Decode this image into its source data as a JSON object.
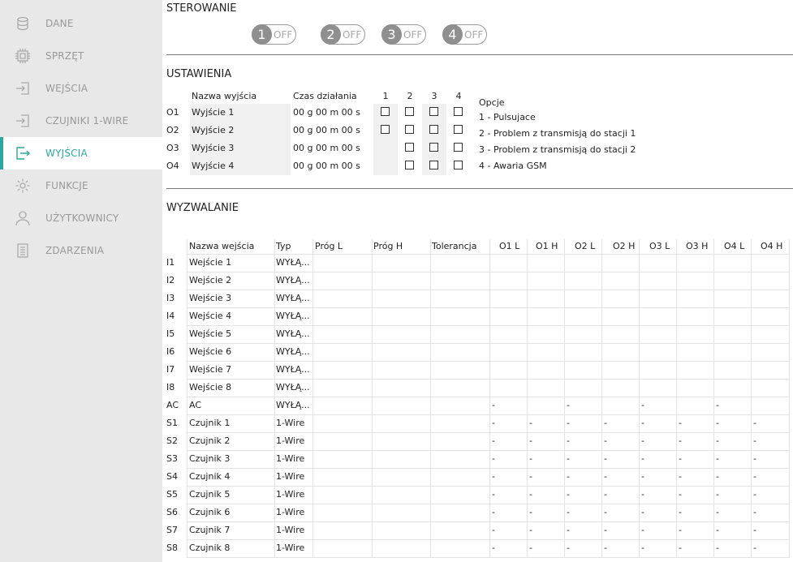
{
  "sidebar": {
    "items": [
      {
        "label": "DANE",
        "icon": "database-icon"
      },
      {
        "label": "SPRZĘT",
        "icon": "chip-icon"
      },
      {
        "label": "WEJŚCIA",
        "icon": "input-icon"
      },
      {
        "label": "CZUJNIKI 1-WIRE",
        "icon": "sensor-input-icon"
      },
      {
        "label": "WYJŚCIA",
        "icon": "output-icon",
        "active": true
      },
      {
        "label": "FUNKCJE",
        "icon": "gear-icon"
      },
      {
        "label": "UŻYTKOWNICY",
        "icon": "user-icon"
      },
      {
        "label": "ZDARZENIA",
        "icon": "list-icon"
      }
    ],
    "accent_color": "#2aa8a0"
  },
  "control": {
    "title": "STEROWANIE",
    "toggles": [
      {
        "number": "1",
        "state": "OFF"
      },
      {
        "number": "2",
        "state": "OFF"
      },
      {
        "number": "3",
        "state": "OFF"
      },
      {
        "number": "4",
        "state": "OFF"
      }
    ]
  },
  "settings": {
    "title": "USTAWIENIA",
    "headers": {
      "name": "Nazwa wyjścia",
      "time": "Czas działania",
      "c1": "1",
      "c2": "2",
      "c3": "3",
      "c4": "4"
    },
    "rows": [
      {
        "id": "O1",
        "name": "Wyjście 1",
        "time": "00 g 00 m 00 s",
        "checks": [
          true,
          true,
          true,
          true
        ]
      },
      {
        "id": "O2",
        "name": "Wyjście 2",
        "time": "00 g 00 m 00 s",
        "checks": [
          true,
          true,
          true,
          true
        ]
      },
      {
        "id": "O3",
        "name": "Wyjście 3",
        "time": "00 g 00 m 00 s",
        "checks": [
          false,
          true,
          true,
          true
        ]
      },
      {
        "id": "O4",
        "name": "Wyjście 4",
        "time": "00 g 00 m 00 s",
        "checks": [
          false,
          true,
          true,
          true
        ]
      }
    ],
    "options_title": "Opcje",
    "options": [
      "1 - Pulsujace",
      "2 - Problem z transmisją do stacji 1",
      "3 - Problem z transmisją do stacji 2",
      "4 - Awaria GSM"
    ]
  },
  "trigger": {
    "title": "WYZWALANIE",
    "headers": [
      "Nazwa wejścia",
      "Typ",
      "Próg L",
      "Próg H",
      "Tolerancja",
      "O1 L",
      "O1 H",
      "O2 L",
      "O2 H",
      "O3 L",
      "O3 H",
      "O4 L",
      "O4 H"
    ],
    "rows": [
      {
        "id": "I1",
        "name": "Wejście 1",
        "type": "WYŁĄ...",
        "cells": [
          "",
          "",
          "",
          "",
          "",
          "",
          "",
          "",
          "",
          "",
          ""
        ]
      },
      {
        "id": "I2",
        "name": "Wejście 2",
        "type": "WYŁĄ...",
        "cells": [
          "",
          "",
          "",
          "",
          "",
          "",
          "",
          "",
          "",
          "",
          ""
        ]
      },
      {
        "id": "I3",
        "name": "Wejście 3",
        "type": "WYŁĄ...",
        "cells": [
          "",
          "",
          "",
          "",
          "",
          "",
          "",
          "",
          "",
          "",
          ""
        ]
      },
      {
        "id": "I4",
        "name": "Wejście 4",
        "type": "WYŁĄ...",
        "cells": [
          "",
          "",
          "",
          "",
          "",
          "",
          "",
          "",
          "",
          "",
          ""
        ]
      },
      {
        "id": "I5",
        "name": "Wejście 5",
        "type": "WYŁĄ...",
        "cells": [
          "",
          "",
          "",
          "",
          "",
          "",
          "",
          "",
          "",
          "",
          ""
        ]
      },
      {
        "id": "I6",
        "name": "Wejście 6",
        "type": "WYŁĄ...",
        "cells": [
          "",
          "",
          "",
          "",
          "",
          "",
          "",
          "",
          "",
          "",
          ""
        ]
      },
      {
        "id": "I7",
        "name": "Wejście 7",
        "type": "WYŁĄ...",
        "cells": [
          "",
          "",
          "",
          "",
          "",
          "",
          "",
          "",
          "",
          "",
          ""
        ]
      },
      {
        "id": "I8",
        "name": "Wejście 8",
        "type": "WYŁĄ...",
        "cells": [
          "",
          "",
          "",
          "",
          "",
          "",
          "",
          "",
          "",
          "",
          ""
        ]
      },
      {
        "id": "AC",
        "name": "AC",
        "type": "WYŁĄ...",
        "cells": [
          "",
          "",
          "",
          "-",
          "",
          "-",
          "",
          "-",
          "",
          "-",
          ""
        ]
      },
      {
        "id": "S1",
        "name": "Czujnik 1",
        "type": "1-Wire",
        "cells": [
          "",
          "",
          "",
          "-",
          "-",
          "-",
          "-",
          "-",
          "-",
          "-",
          "-"
        ]
      },
      {
        "id": "S2",
        "name": "Czujnik 2",
        "type": "1-Wire",
        "cells": [
          "",
          "",
          "",
          "-",
          "-",
          "-",
          "-",
          "-",
          "-",
          "-",
          "-"
        ]
      },
      {
        "id": "S3",
        "name": "Czujnik 3",
        "type": "1-Wire",
        "cells": [
          "",
          "",
          "",
          "-",
          "-",
          "-",
          "-",
          "-",
          "-",
          "-",
          "-"
        ]
      },
      {
        "id": "S4",
        "name": "Czujnik 4",
        "type": "1-Wire",
        "cells": [
          "",
          "",
          "",
          "-",
          "-",
          "-",
          "-",
          "-",
          "-",
          "-",
          "-"
        ]
      },
      {
        "id": "S5",
        "name": "Czujnik 5",
        "type": "1-Wire",
        "cells": [
          "",
          "",
          "",
          "-",
          "-",
          "-",
          "-",
          "-",
          "-",
          "-",
          "-"
        ]
      },
      {
        "id": "S6",
        "name": "Czujnik 6",
        "type": "1-Wire",
        "cells": [
          "",
          "",
          "",
          "-",
          "-",
          "-",
          "-",
          "-",
          "-",
          "-",
          "-"
        ]
      },
      {
        "id": "S7",
        "name": "Czujnik 7",
        "type": "1-Wire",
        "cells": [
          "",
          "",
          "",
          "-",
          "-",
          "-",
          "-",
          "-",
          "-",
          "-",
          "-"
        ]
      },
      {
        "id": "S8",
        "name": "Czujnik 8",
        "type": "1-Wire",
        "cells": [
          "",
          "",
          "",
          "-",
          "-",
          "-",
          "-",
          "-",
          "-",
          "-",
          "-"
        ]
      }
    ]
  }
}
